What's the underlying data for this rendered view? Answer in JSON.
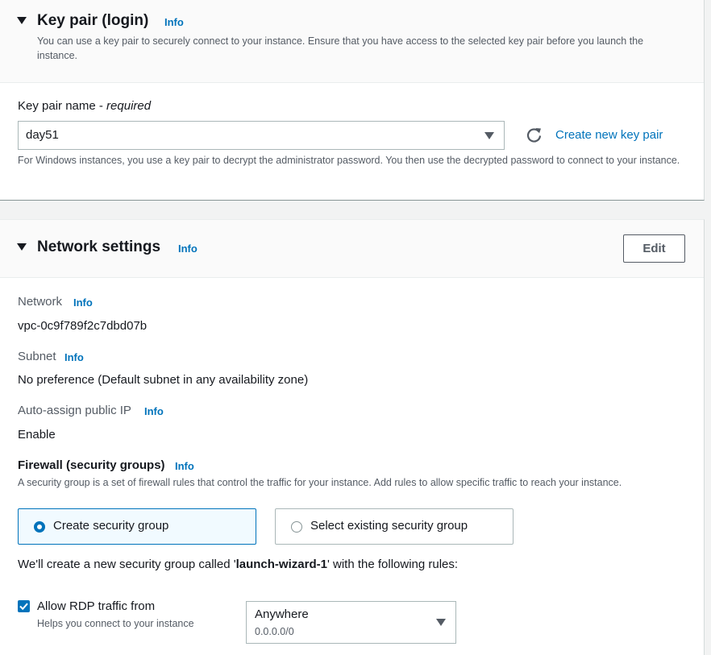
{
  "keypair": {
    "title": "Key pair (login)",
    "info": "Info",
    "description": "You can use a key pair to securely connect to your instance. Ensure that you have access to the selected key pair before you launch the instance.",
    "field_label": "Key pair name - ",
    "field_required": "required",
    "selected": "day51",
    "create_link": "Create new key pair",
    "help": "For Windows instances, you use a key pair to decrypt the administrator password. You then use the decrypted password to connect to your instance."
  },
  "network": {
    "title": "Network settings",
    "info": "Info",
    "edit_label": "Edit",
    "network_label": "Network",
    "network_value": "vpc-0c9f789f2c7dbd07b",
    "subnet_label": "Subnet",
    "subnet_value": "No preference (Default subnet in any availability zone)",
    "public_ip_label": "Auto-assign public IP",
    "public_ip_value": "Enable",
    "firewall_label": "Firewall (security groups)",
    "firewall_desc": "A security group is a set of firewall rules that control the traffic for your instance. Add rules to allow specific traffic to reach your instance.",
    "options": [
      {
        "label": "Create security group",
        "selected": true
      },
      {
        "label": "Select existing security group",
        "selected": false
      }
    ],
    "sg_note_prefix": "We'll create a new security group called '",
    "sg_name": "launch-wizard-1",
    "sg_note_suffix": "' with the following rules:",
    "rdp": {
      "label": "Allow RDP traffic from",
      "help": "Helps you connect to your instance",
      "checked": true,
      "source": "Anywhere",
      "cidr": "0.0.0.0/0"
    }
  },
  "colors": {
    "accent": "#0073bb",
    "selected_tile_bg": "#f1faff"
  }
}
